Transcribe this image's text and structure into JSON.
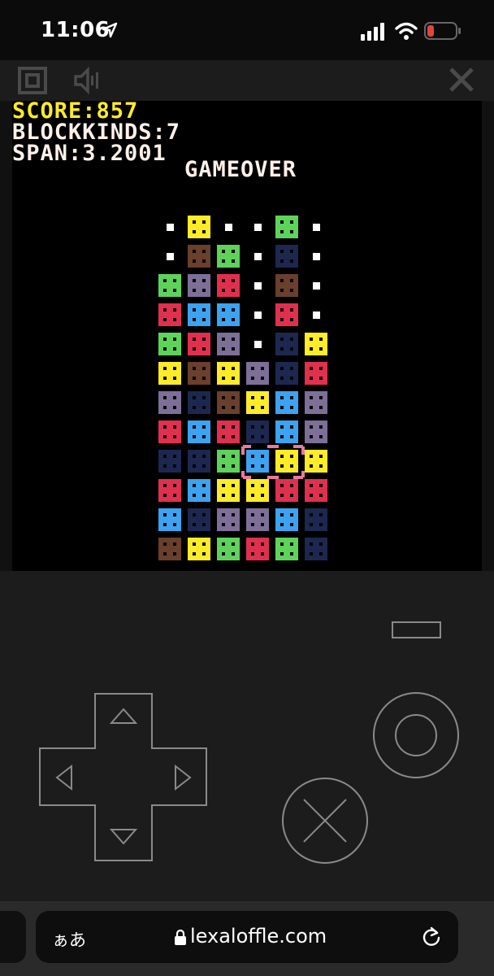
{
  "status_bar": {
    "time": "11:06",
    "icons": [
      "location-arrow-icon",
      "cellular-signal-icon",
      "wifi-icon",
      "battery-low-icon"
    ],
    "battery_color": "#e0453a"
  },
  "toolbar": {
    "icons": [
      "fullscreen-icon",
      "sound-icon",
      "close-icon"
    ]
  },
  "hud": {
    "score": "SCORE:857",
    "block_kinds": "BLOCKKINDS:7",
    "span": "SPAN:3.2001",
    "status": "GAMEOVER"
  },
  "board": {
    "columns": 6,
    "rows": 12,
    "legend": {
      "Y": "#ffec27",
      "G": "#5ed35a",
      "B": "#6a3f2c",
      "N": "#1d2850",
      "P": "#7d6f97",
      "R": "#e0304e",
      "L": "#3da2ef",
      ".": "empty-pip"
    },
    "grid": [
      ".Y..G.",
      ".BG.N.",
      "GPR.B.",
      "RLL.R.",
      "GRP.NY",
      "YBYPNR",
      "PNBYLP",
      "RLRNLP",
      "NNGLYY",
      "RLYYRR",
      "LNPPLN",
      "BYGRGN"
    ],
    "cursor": {
      "row": 8,
      "col": 3,
      "width_cells": 2,
      "color": "#e87aa0"
    }
  },
  "controls": {
    "dpad": [
      "dpad-up-button",
      "dpad-down-button",
      "dpad-left-button",
      "dpad-right-button"
    ],
    "buttons": [
      "menu-button",
      "o-button",
      "x-button"
    ],
    "line_color": "#8a8a8a"
  },
  "browser": {
    "text_size_label": "ぁあ",
    "url": "lexaloffle.com"
  }
}
